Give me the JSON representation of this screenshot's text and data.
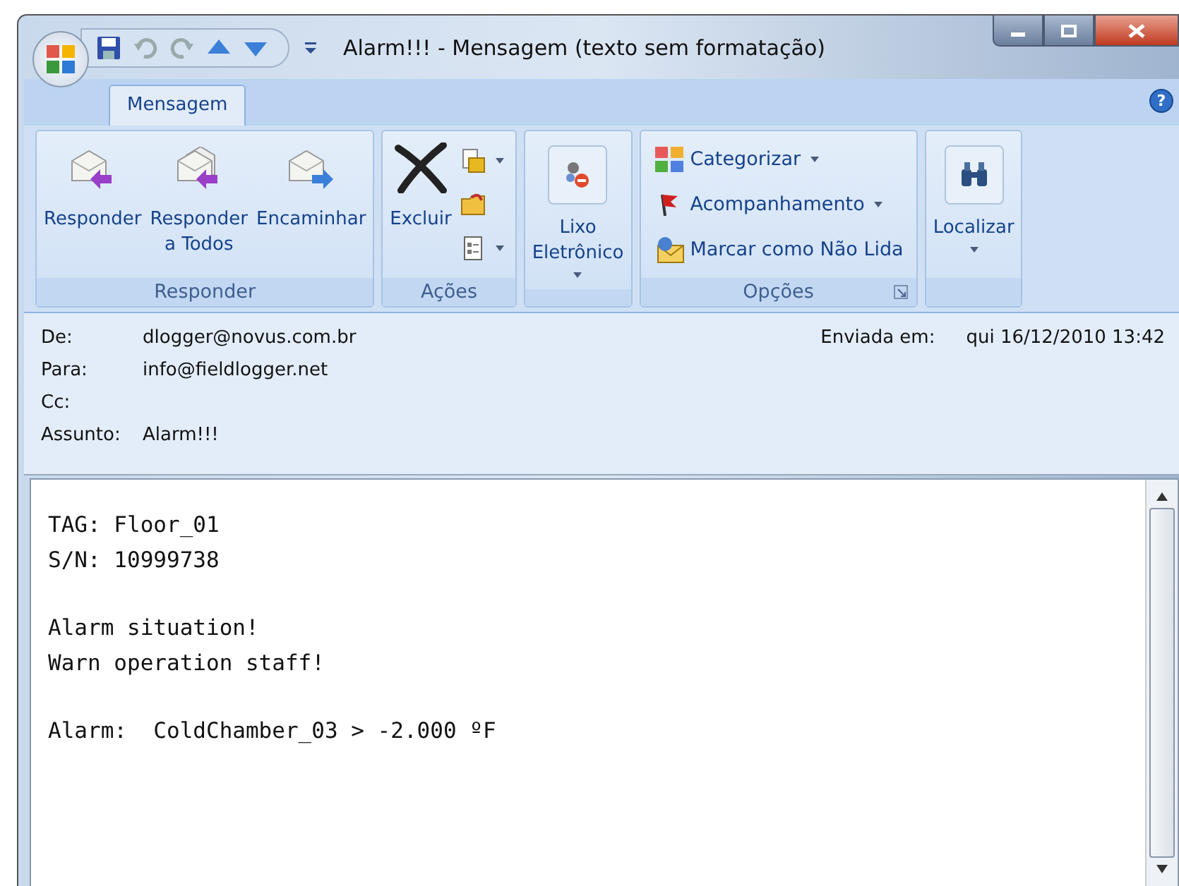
{
  "window": {
    "title": "Alarm!!! - Mensagem (texto sem formatação)"
  },
  "tabs": [
    {
      "label": "Mensagem",
      "selected": true
    }
  ],
  "help": {
    "label": "?"
  },
  "ribbon": [
    {
      "label": "Responder",
      "buttons": [
        {
          "kind": "reply",
          "label": "Responder"
        },
        {
          "kind": "reply-all",
          "label": "Responder\na Todos"
        },
        {
          "kind": "forward",
          "label": "Encaminhar"
        }
      ]
    },
    {
      "label": "Ações",
      "buttons": [
        {
          "kind": "delete",
          "label": "Excluir"
        }
      ],
      "small": [
        {
          "kind": "move",
          "dropdown": true
        },
        {
          "kind": "folder",
          "dropdown": false
        },
        {
          "kind": "other",
          "dropdown": true
        }
      ]
    },
    {
      "buttons": [
        {
          "kind": "junk",
          "label": "Lixo\nEletrônico",
          "dropdown": true
        }
      ]
    },
    {
      "label": "Opções",
      "items": [
        {
          "kind": "categorize",
          "label": "Categorizar",
          "dropdown": true
        },
        {
          "kind": "flag",
          "label": "Acompanhamento",
          "dropdown": true
        },
        {
          "kind": "unread",
          "label": "Marcar como Não Lida",
          "dropdown": false
        }
      ]
    },
    {
      "buttons": [
        {
          "kind": "find",
          "label": "Localizar",
          "dropdown": true
        }
      ]
    }
  ],
  "header": {
    "fields": [
      {
        "label": "De:",
        "value": "dlogger@novus.com.br"
      },
      {
        "label": "Para:",
        "value": "info@fieldlogger.net"
      },
      {
        "label": "Cc:"
      },
      {
        "label": "Assunto:",
        "value": "Alarm!!!"
      }
    ],
    "sent": {
      "label": "Enviada em:",
      "value": "qui 16/12/2010 13:42"
    }
  },
  "body": [
    [
      "TAG: Floor_01",
      "S/N: 10999738"
    ],
    [
      "Alarm situation!",
      "Warn operation staff!"
    ],
    [
      "Alarm:  ColdChamber_03 > -2.000 ºF"
    ]
  ]
}
